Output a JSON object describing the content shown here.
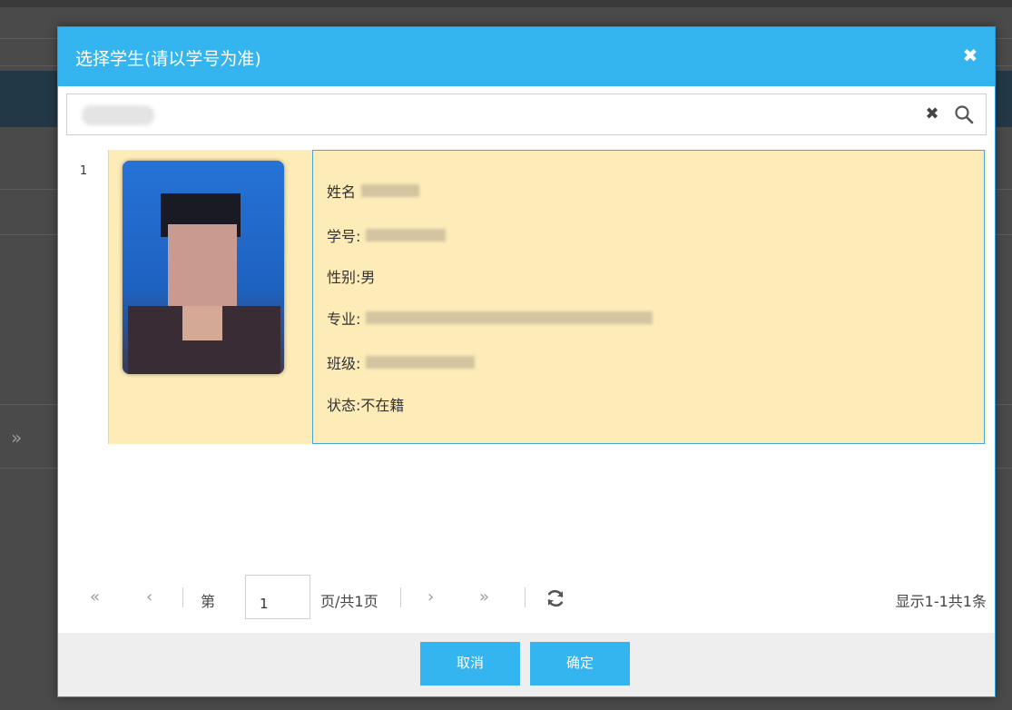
{
  "dialog": {
    "title": "选择学生(请以学号为准)",
    "close_icon": "close-icon"
  },
  "search": {
    "clear_icon": "clear-icon",
    "search_icon": "search-icon"
  },
  "result": {
    "row_number": "1",
    "fields": {
      "name_label": "姓名",
      "student_id_label": "学号:",
      "gender_label": "性别:",
      "gender_value": "男",
      "major_label": "专业:",
      "class_label": "班级:",
      "status_label": "状态:",
      "status_value": "不在籍"
    }
  },
  "pagination": {
    "page_prefix": "第",
    "page_value": "1",
    "page_suffix": "页/共1页",
    "total_text": "显示1-1共1条"
  },
  "footer": {
    "cancel_label": "取消",
    "confirm_label": "确定"
  },
  "colors": {
    "header": "#35b5f0",
    "row_highlight": "#fdebb8",
    "button": "#35b5f0"
  }
}
